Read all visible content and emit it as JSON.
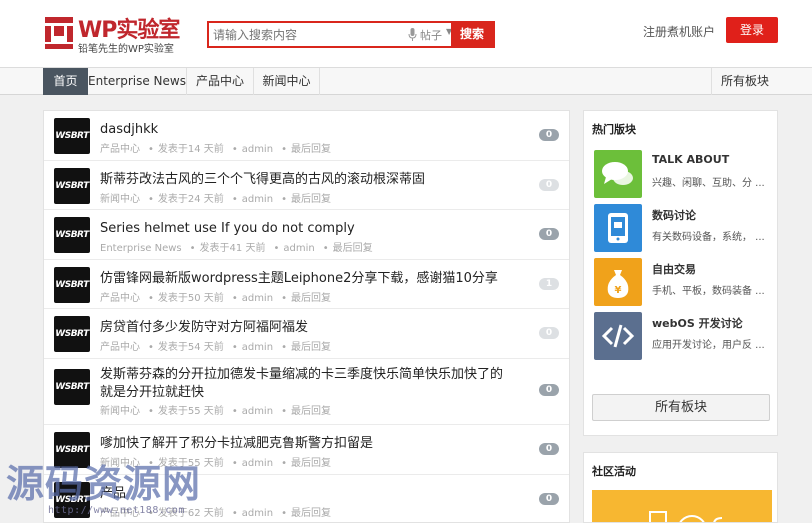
{
  "header": {
    "logo_title": "WP实验室",
    "logo_subtitle": "铅笔先生的WP实验室",
    "search_placeholder": "请输入搜索内容",
    "search_type": "帖子",
    "search_button": "搜索",
    "register": "注册煮机账户",
    "login": "登录",
    "brand_color": "#d9261c"
  },
  "nav": {
    "items": [
      "首页",
      "Enterprise News",
      "产品中心",
      "新闻中心"
    ],
    "active_index": 0,
    "all_boards": "所有板块"
  },
  "topics": [
    {
      "avatar": "WSBRT",
      "title": "dasdjhkk",
      "category": "产品中心",
      "posted": "发表于14 天前",
      "author": "admin",
      "last": "最后回复",
      "count": "0",
      "count_style": "dark"
    },
    {
      "avatar": "WSBRT",
      "title": "斯蒂芬改法古风的三个个飞得更高的古风的滚动根深蒂固",
      "category": "新闻中心",
      "posted": "发表于24 天前",
      "author": "admin",
      "last": "最后回复",
      "count": "0",
      "count_style": "light"
    },
    {
      "avatar": "WSBRT",
      "title": "Series helmet use If you do not comply",
      "category": "Enterprise News",
      "posted": "发表于41 天前",
      "author": "admin",
      "last": "最后回复",
      "count": "0",
      "count_style": "dark"
    },
    {
      "avatar": "WSBRT",
      "title": "仿雷锋网最新版wordpress主题Leiphone2分享下载，感谢猫10分享",
      "category": "产品中心",
      "posted": "发表于50 天前",
      "author": "admin",
      "last": "最后回复",
      "count": "1",
      "count_style": "light"
    },
    {
      "avatar": "WSBRT",
      "title": "房贷首付多少发防守对方阿福阿福发",
      "category": "产品中心",
      "posted": "发表于54 天前",
      "author": "admin",
      "last": "最后回复",
      "count": "0",
      "count_style": "light"
    },
    {
      "avatar": "WSBRT",
      "title": "发斯蒂芬森的分开拉加德发卡量缩减的卡三季度快乐简单快乐加快了的就是分开拉就赶快",
      "category": "新闻中心",
      "posted": "发表于55 天前",
      "author": "admin",
      "last": "最后回复",
      "count": "0",
      "count_style": "dark"
    },
    {
      "avatar": "WSBRT",
      "title": "嗲加快了解开了积分卡拉减肥克鲁斯警方扣留是",
      "category": "新闻中心",
      "posted": "发表于55 天前",
      "author": "admin",
      "last": "最后回复",
      "count": "0",
      "count_style": "dark"
    },
    {
      "avatar": "WSBRT",
      "title": "产品",
      "category": "产品中心",
      "posted": "发表于62 天前",
      "author": "admin",
      "last": "最后回复",
      "count": "0",
      "count_style": "dark"
    }
  ],
  "sidebar": {
    "hot_title": "热门版块",
    "boards": [
      {
        "name": "TALK ABOUT",
        "desc": "兴趣、闲聊、互助、分 ...",
        "icon": "chat-bubbles-icon",
        "color": "#6cbf3a"
      },
      {
        "name": "数码讨论",
        "desc": "有关数码设备，系统， ...",
        "icon": "tablet-icon",
        "color": "#2f8ad8"
      },
      {
        "name": "自由交易",
        "desc": "手机、平板，数码装备 ...",
        "icon": "money-bag-icon",
        "color": "#f0a21b"
      },
      {
        "name": "webOS 开发讨论",
        "desc": "应用开发讨论，用户反 ...",
        "icon": "code-icon",
        "color": "#5b6f8f"
      }
    ],
    "all_boards_button": "所有板块",
    "activity_title": "社区活动"
  },
  "watermark": {
    "text": "源码资源网",
    "url": "http://www.net188.com"
  }
}
